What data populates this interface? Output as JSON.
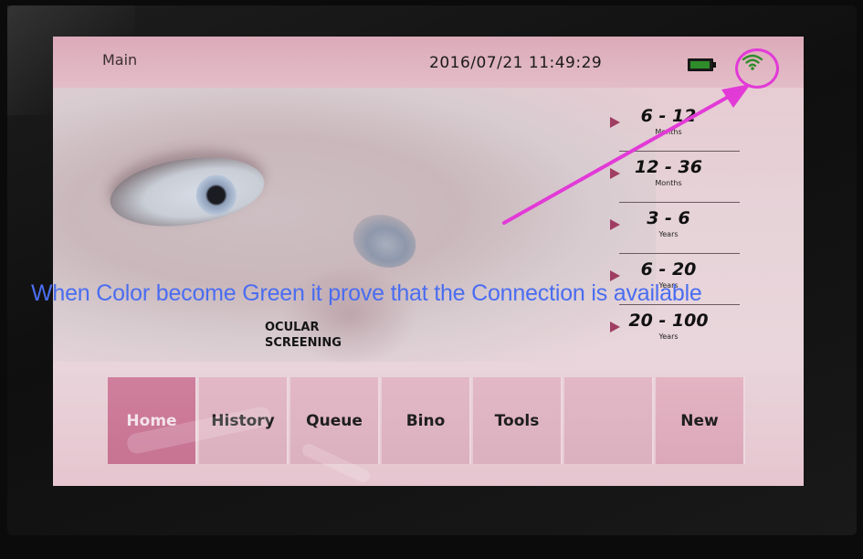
{
  "status_bar": {
    "title": "Main",
    "datetime": "2016/07/21 11:49:29",
    "battery_icon": "battery-icon",
    "wifi_icon": "wifi-icon",
    "wifi_color": "#2e8c2a"
  },
  "splash": {
    "line1": "OCULAR",
    "line2": "SCREENING"
  },
  "age_ranges": [
    {
      "value": "6 - 12",
      "unit": "Months"
    },
    {
      "value": "12 - 36",
      "unit": "Months"
    },
    {
      "value": "3 - 6",
      "unit": "Years"
    },
    {
      "value": "6 - 20",
      "unit": "Years"
    },
    {
      "value": "20 - 100",
      "unit": "Years"
    }
  ],
  "nav": [
    {
      "label": "Home"
    },
    {
      "label": "History"
    },
    {
      "label": "Queue"
    },
    {
      "label": "Bino"
    },
    {
      "label": "Tools"
    },
    {
      "label": ""
    },
    {
      "label": "New"
    }
  ],
  "annotation": {
    "text": "When Color become Green it prove that the Connection is available",
    "color": "#4a6df0",
    "highlight_color": "#e23ad7"
  }
}
